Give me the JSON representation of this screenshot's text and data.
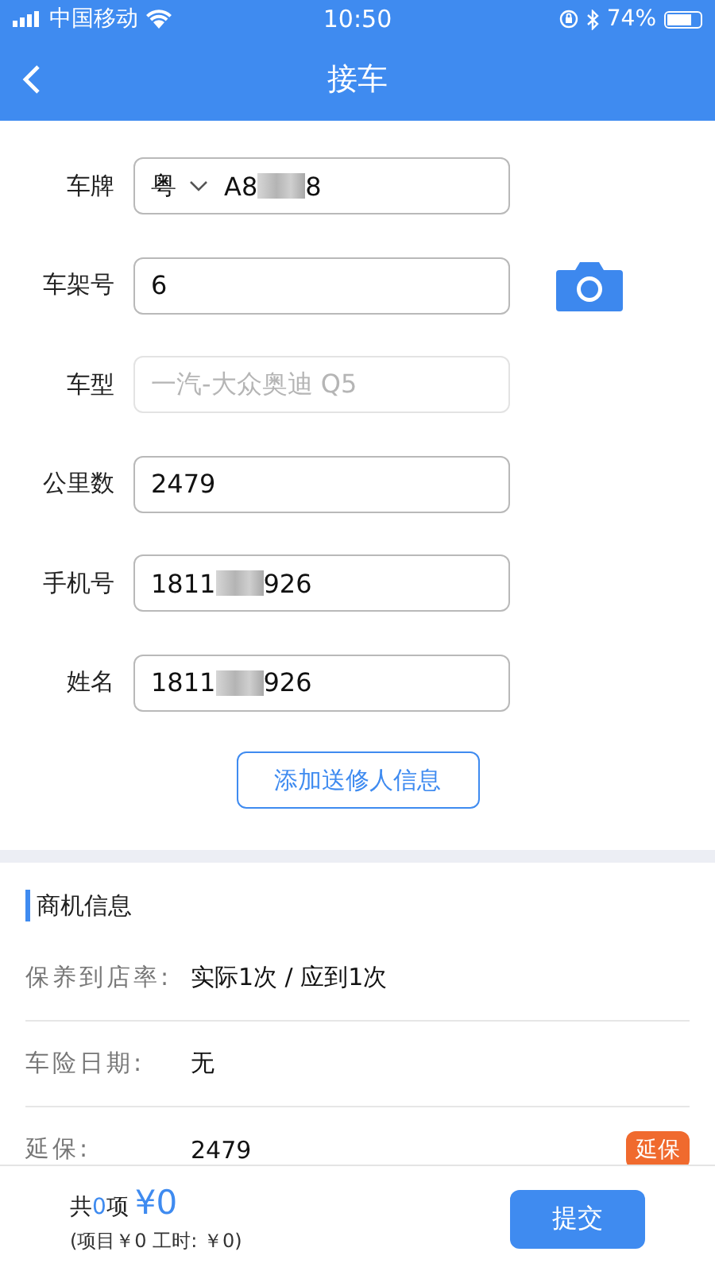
{
  "status_bar": {
    "carrier": "中国移动",
    "time": "10:50",
    "battery": "74%"
  },
  "header": {
    "title": "接车"
  },
  "form": [
    {
      "label": "车牌",
      "kind": "plate",
      "province": "粤",
      "value_start": "A8",
      "masked": true,
      "value_end": "8"
    },
    {
      "label": "车架号",
      "kind": "text",
      "value_start": "6",
      "masked": false,
      "camera": true
    },
    {
      "label": "车型",
      "kind": "disabled",
      "value_start": "一汽-大众奥迪 Q5",
      "masked": false
    },
    {
      "label": "公里数",
      "kind": "text",
      "value_start": "2479",
      "masked": false
    },
    {
      "label": "手机号",
      "kind": "text",
      "value_start": "1811",
      "masked": true,
      "value_end": "926"
    },
    {
      "label": "姓名",
      "kind": "text",
      "value_start": "1811",
      "masked": true,
      "value_end": "926"
    }
  ],
  "add_button": "添加送修人信息",
  "section": {
    "title": "商机信息",
    "rows": [
      {
        "label": "保养到店率:",
        "value": "实际1次 / 应到1次"
      },
      {
        "label": "车险日期:",
        "value": "无"
      },
      {
        "label": "延保:",
        "value": "2479",
        "tag": "延保"
      }
    ]
  },
  "footer": {
    "count_prefix": "共",
    "count": "0",
    "count_suffix": "项",
    "total": "¥0",
    "detail": "(项目￥0 工时: ￥0)",
    "submit": "提交"
  }
}
